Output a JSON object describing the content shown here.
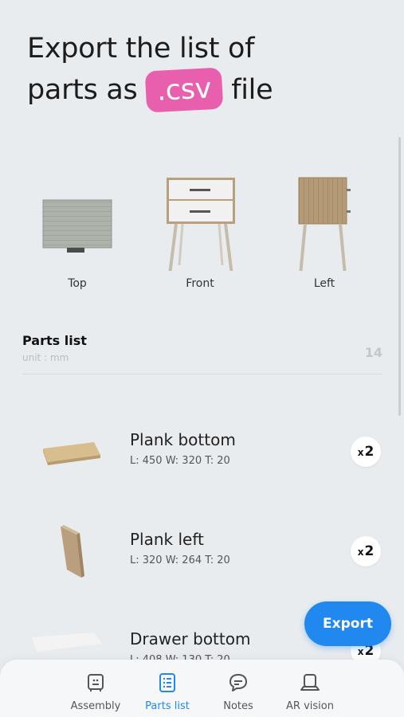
{
  "headline": {
    "line1": "Export the list of",
    "line2_prefix": "parts as",
    "highlight": ".csv",
    "line2_suffix": "file"
  },
  "views": [
    {
      "label": "Top"
    },
    {
      "label": "Front"
    },
    {
      "label": "Left"
    }
  ],
  "parts_list": {
    "title": "Parts list",
    "unit": "unit : mm",
    "count": "14",
    "items": [
      {
        "name": "Plank bottom",
        "dims": "L: 450  W: 320  T: 20",
        "qty_prefix": "x",
        "qty": "2"
      },
      {
        "name": "Plank left",
        "dims": "L: 320  W: 264  T: 20",
        "qty_prefix": "x",
        "qty": "2"
      },
      {
        "name": "Drawer bottom",
        "dims": "L: 408  W: 130  T: 20",
        "qty_prefix": "x",
        "qty": "2"
      }
    ]
  },
  "export_button": "Export",
  "bottom_nav": [
    {
      "label": "Assembly",
      "icon": "assembly-icon"
    },
    {
      "label": "Parts list",
      "icon": "list-icon",
      "active": true
    },
    {
      "label": "Notes",
      "icon": "chat-icon"
    },
    {
      "label": "AR vision",
      "icon": "ar-icon"
    }
  ],
  "colors": {
    "background": "#e9ecef",
    "highlight": "#e85fae",
    "accent": "#2188f0"
  }
}
